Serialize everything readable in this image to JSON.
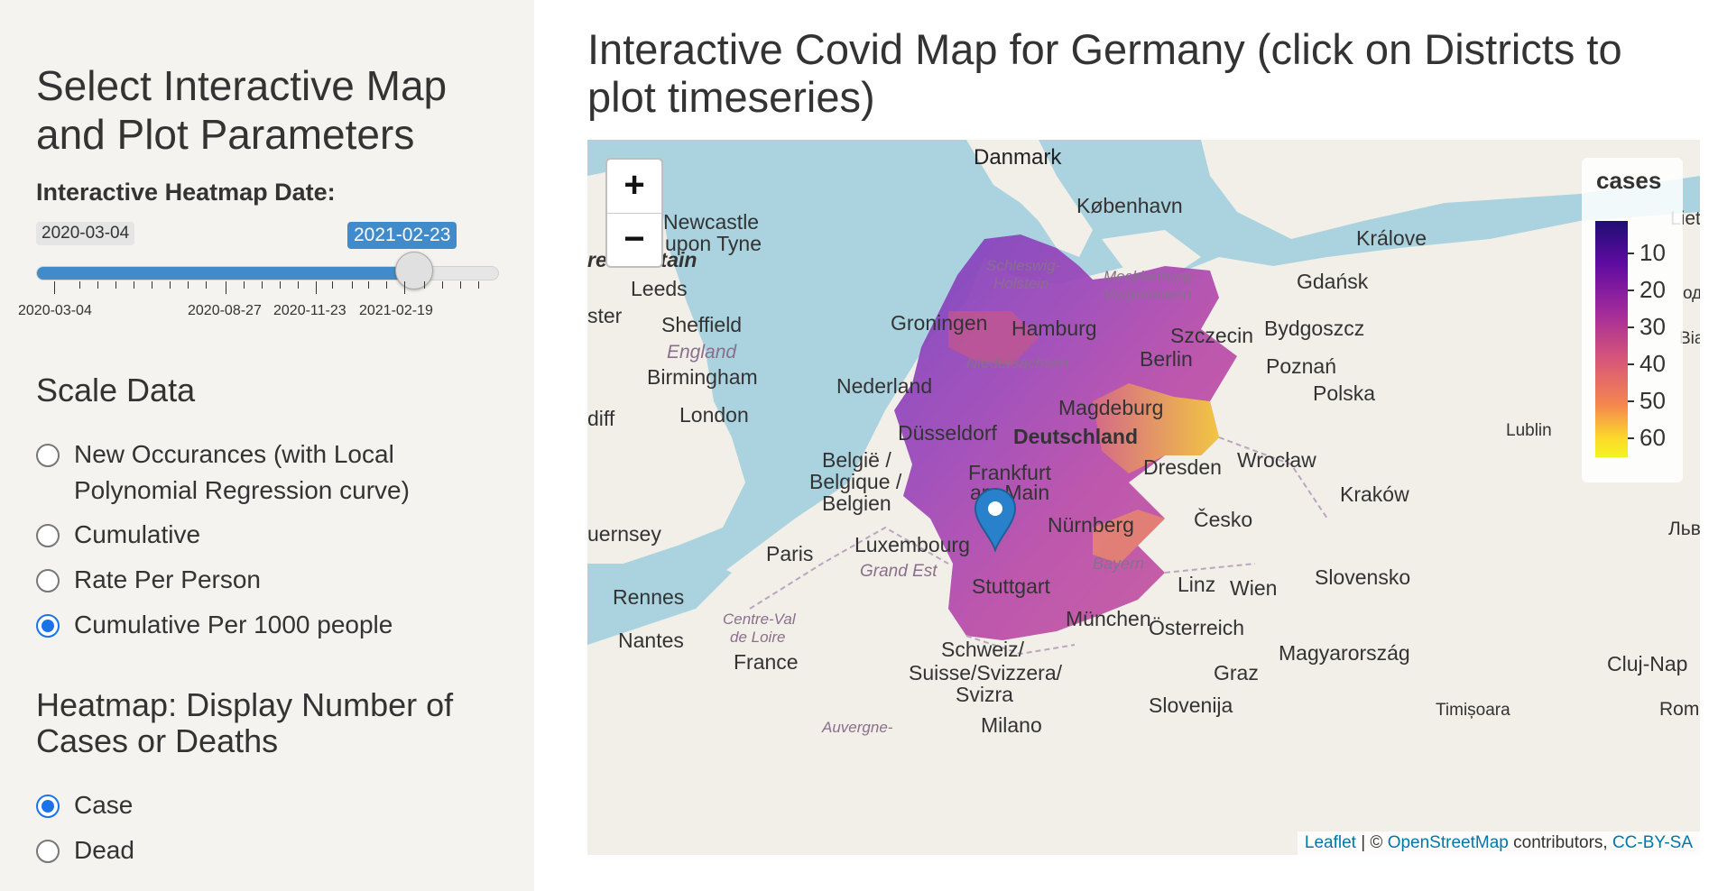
{
  "sidebar": {
    "title": "Select Interactive Map and Plot Parameters",
    "slider": {
      "label": "Interactive Heatmap Date:",
      "min_label": "2020-03-04",
      "current_value": "2021-02-23",
      "fraction": 0.82,
      "tick_labels": [
        "2020-03-04",
        "2020-08-27",
        "2020-11-23",
        "2021-02-19"
      ]
    },
    "scale": {
      "title": "Scale Data",
      "options": [
        {
          "label": "New Occurances (with Local Polynomial Regression curve)",
          "checked": false
        },
        {
          "label": "Cumulative",
          "checked": false
        },
        {
          "label": "Rate Per Person",
          "checked": false
        },
        {
          "label": "Cumulative Per 1000 people",
          "checked": true
        }
      ]
    },
    "heatmap": {
      "title": "Heatmap: Display Number of Cases or Deaths",
      "options": [
        {
          "label": "Case",
          "checked": true
        },
        {
          "label": "Dead",
          "checked": false
        }
      ]
    }
  },
  "main": {
    "title": "Interactive Covid Map for Germany (click on Districts to plot timeseries)"
  },
  "map": {
    "zoom_in": "+",
    "zoom_out": "−",
    "labels": {
      "danmark": "Danmark",
      "kobenhavn": "København",
      "newcastle": "Newcastle",
      "upon_tyne": "upon Tyne",
      "great_britain": "reat Britain",
      "leeds": "Leeds",
      "ster": "ster",
      "sheffield": "Sheffield",
      "england": "England",
      "birmingham": "Birmingham",
      "diff": "diff",
      "london": "London",
      "groningen": "Groningen",
      "hamburg": "Hamburg",
      "schleswig": "Schleswig-",
      "holstein": "Holstein",
      "mecklenburg": "Mecklenburg-",
      "vorpommern": "Vorpommern",
      "szczecin": "Szczecin",
      "berlin": "Berlin",
      "niedersachsen": "Niedersachsen",
      "nederland": "Nederland",
      "magdeburg": "Magdeburg",
      "dusseldorf": "Düsseldorf",
      "deutschland": "Deutschland",
      "dresden": "Dresden",
      "belgie1": "België /",
      "belgie2": "Belgique /",
      "belgie3": "Belgien",
      "frankfurt1": "Frankfurt",
      "frankfurt2": "am Main",
      "nurnberg": "Nürnberg",
      "luxembourg": "Luxembourg",
      "grand_est": "Grand Est",
      "bayern": "Bayern",
      "stuttgart": "Stuttgart",
      "munchen": "München",
      "paris": "Paris",
      "rennes": "Rennes",
      "guernsey": "uernsey",
      "centre_val1": "Centre-Val",
      "centre_val2": "de Loire",
      "nantes": "Nantes",
      "france": "France",
      "schweiz1": "Schweiz/",
      "schweiz2": "Suisse/Svizzera/",
      "schweiz3": "Svizra",
      "auvergne": "Auvergne-",
      "milano": "Milano",
      "osterreich": "Österreich",
      "linz": "Linz",
      "wien": "Wien",
      "graz": "Graz",
      "slovenija": "Slovenija",
      "timisoara": "Timișoara",
      "rom": "Rom",
      "magyarorszag": "Magyarország",
      "cluj": "Cluj-Nap",
      "slovensko": "Slovensko",
      "cesko": "Česko",
      "krakow": "Kraków",
      "wroclaw": "Wrocław",
      "lublin": "Lublin",
      "lviv": "Льв",
      "polska": "Polska",
      "poznan": "Poznań",
      "bydgoszcz": "Bydgoszcz",
      "gdansk": "Gdańsk",
      "kralove": "Králove",
      "liet": "Liet",
      "bial": "Bia",
      "od": "од"
    },
    "legend": {
      "title": "cases",
      "values": [
        "10",
        "20",
        "30",
        "40",
        "50",
        "60"
      ]
    },
    "attribution": {
      "leaflet": "Leaflet",
      "sep": " | © ",
      "osm": "OpenStreetMap",
      "contrib": " contributors, ",
      "license": "CC-BY-SA"
    }
  },
  "colors": {
    "accent": "#428bca",
    "radio_checked": "#1a73e8",
    "water": "#aad3df",
    "land": "#f2efe9",
    "marker": "#2a81cb"
  }
}
